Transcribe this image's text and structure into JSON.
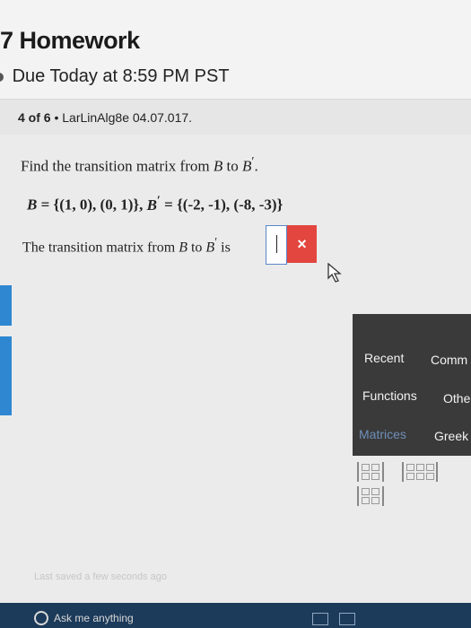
{
  "header": {
    "title_prefix": "7",
    "title": "Homework",
    "due": "Due Today at 8:59 PM PST"
  },
  "progress": {
    "position": "4 of 6",
    "separator": "•",
    "assignment": "LarLinAlg8e 04.07.017."
  },
  "question": {
    "prompt_prefix": "Find the transition matrix from",
    "prompt_to": "to",
    "basis_b": "B",
    "basis_b_prime": "B",
    "prime": "′",
    "prompt_end": ".",
    "eq_b_value": "= {(1, 0), (0, 1)},",
    "eq_bp_value": "= {(-2, -1), (-8, -3)}",
    "answer_prefix": "The transition matrix from",
    "answer_to": "to",
    "answer_is": "is",
    "clear_label": "×"
  },
  "palette": {
    "tabs": [
      {
        "label": "Recent"
      },
      {
        "label": "Comm"
      },
      {
        "label": "Functions"
      },
      {
        "label": "Othe"
      },
      {
        "label": "Matrices"
      },
      {
        "label": "Greek"
      }
    ],
    "active_tab": "Matrices"
  },
  "status": {
    "saved": "Last saved a few seconds ago"
  },
  "taskbar": {
    "search_placeholder": "Ask me anything"
  },
  "colors": {
    "clear_button": "#e2463f",
    "answer_border": "#5a86c8",
    "palette_bg": "#3a3a3a",
    "side_tab": "#2f87d1",
    "taskbar": "#1c3a5a"
  }
}
